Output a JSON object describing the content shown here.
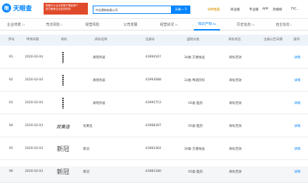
{
  "header": {
    "logo_text": "天眼查",
    "banner_lines": [
      "国家中小企业发展子基金旗下",
      "官方备案企业征信机构"
    ],
    "search_value": "中交建筑有限公司",
    "search_button": "天眼一下",
    "nav": {
      "vip": "VIP会员",
      "business": "商业版",
      "pro": "专业版",
      "app": "APP",
      "hotline": "热搜榜",
      "user": "TYC..."
    }
  },
  "tabs": [
    {
      "label": "企业背景",
      "count": "13"
    },
    {
      "label": "司法风险",
      "count": "3"
    },
    {
      "label": "经营风险",
      "count": ""
    },
    {
      "label": "公司发展",
      "count": ""
    },
    {
      "label": "经营状况",
      "count": "16"
    },
    {
      "label": "知识产权",
      "count": "96"
    },
    {
      "label": "历史信息",
      "count": "54"
    },
    {
      "label": "自主信息",
      "count": "1"
    }
  ],
  "table": {
    "columns": [
      "序号",
      "申请日期",
      "商标",
      "商标名称",
      "注册号",
      "国际分类",
      "商标状态",
      "注册公告日期",
      "操作"
    ],
    "rows": [
      {
        "index": "91",
        "date": "2020-02-04",
        "thumb": "vert",
        "name": "清瑶务居",
        "reg_no": "43994167",
        "class": "30类-方便食品",
        "status": "商标无效",
        "action": "详情"
      },
      {
        "index": "92",
        "date": "2020-02-04",
        "thumb": "vert",
        "name": "清瑶务居",
        "reg_no": "43993088",
        "class": "33类-啤酒饮料",
        "status": "商标无效",
        "action": "详情"
      },
      {
        "index": "93",
        "date": "2020-02-04",
        "thumb": "vert",
        "name": "清瑶务居",
        "reg_no": "43995753",
        "class": "05类-医药",
        "status": "商标无效",
        "action": "详情"
      },
      {
        "index": "94",
        "date": "2020-02-03",
        "thumb": "script",
        "thumb_text": "双黄连",
        "name": "双黄连",
        "reg_no": "43988397",
        "class": "05类-医药",
        "status": "商标无效",
        "action": "详情"
      },
      {
        "index": "95",
        "date": "2020-02-03",
        "thumb": "hanzi",
        "thumb_text": "新冠",
        "name": "新冠",
        "reg_no": "43983364",
        "class": "30类-方便食品",
        "status": "商标无效",
        "action": "详情"
      },
      {
        "index": "96",
        "date": "2020-02-03",
        "thumb": "hanzi",
        "thumb_text": "新冠",
        "name": "新冠",
        "reg_no": "43981180",
        "class": "05类-医药",
        "status": "商标无效",
        "action": "详情"
      }
    ]
  }
}
